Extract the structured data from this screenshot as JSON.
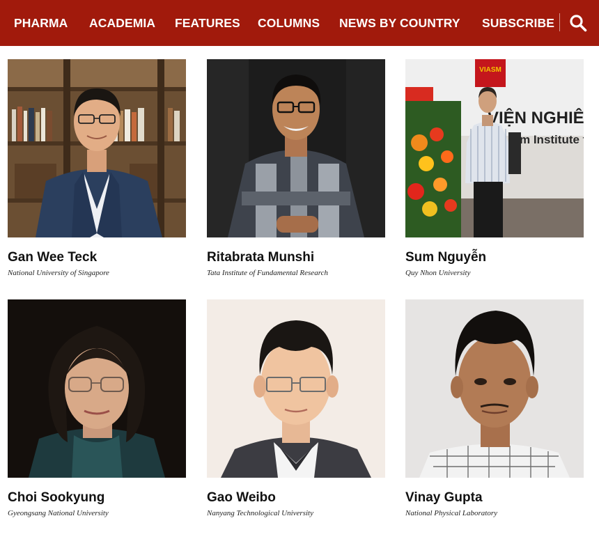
{
  "nav": {
    "items": [
      {
        "label": "PHARMA"
      },
      {
        "label": "ACADEMIA"
      },
      {
        "label": "FEATURES"
      },
      {
        "label": "COLUMNS"
      },
      {
        "label": "NEWS BY COUNTRY"
      }
    ],
    "subscribe": "SUBSCRIBE",
    "search_icon": "search-icon",
    "bg_color": "#a11a0c"
  },
  "people": [
    {
      "name": "Gan Wee Teck",
      "affiliation": "National University of Singapore"
    },
    {
      "name": "Ritabrata Munshi",
      "affiliation": "Tata Institute of Fundamental Research"
    },
    {
      "name": "Sum Nguyễn",
      "affiliation": "Quy Nhon University",
      "photo_sign_text": "VIASM",
      "photo_wall_text": "VIỆN NGHIÊN",
      "photo_wall_text_2": "m Institute f"
    },
    {
      "name": "Choi Sookyung",
      "affiliation": "Gyeongsang National University"
    },
    {
      "name": "Gao Weibo",
      "affiliation": "Nanyang Technological University"
    },
    {
      "name": "Vinay Gupta",
      "affiliation": "National Physical Laboratory"
    }
  ]
}
